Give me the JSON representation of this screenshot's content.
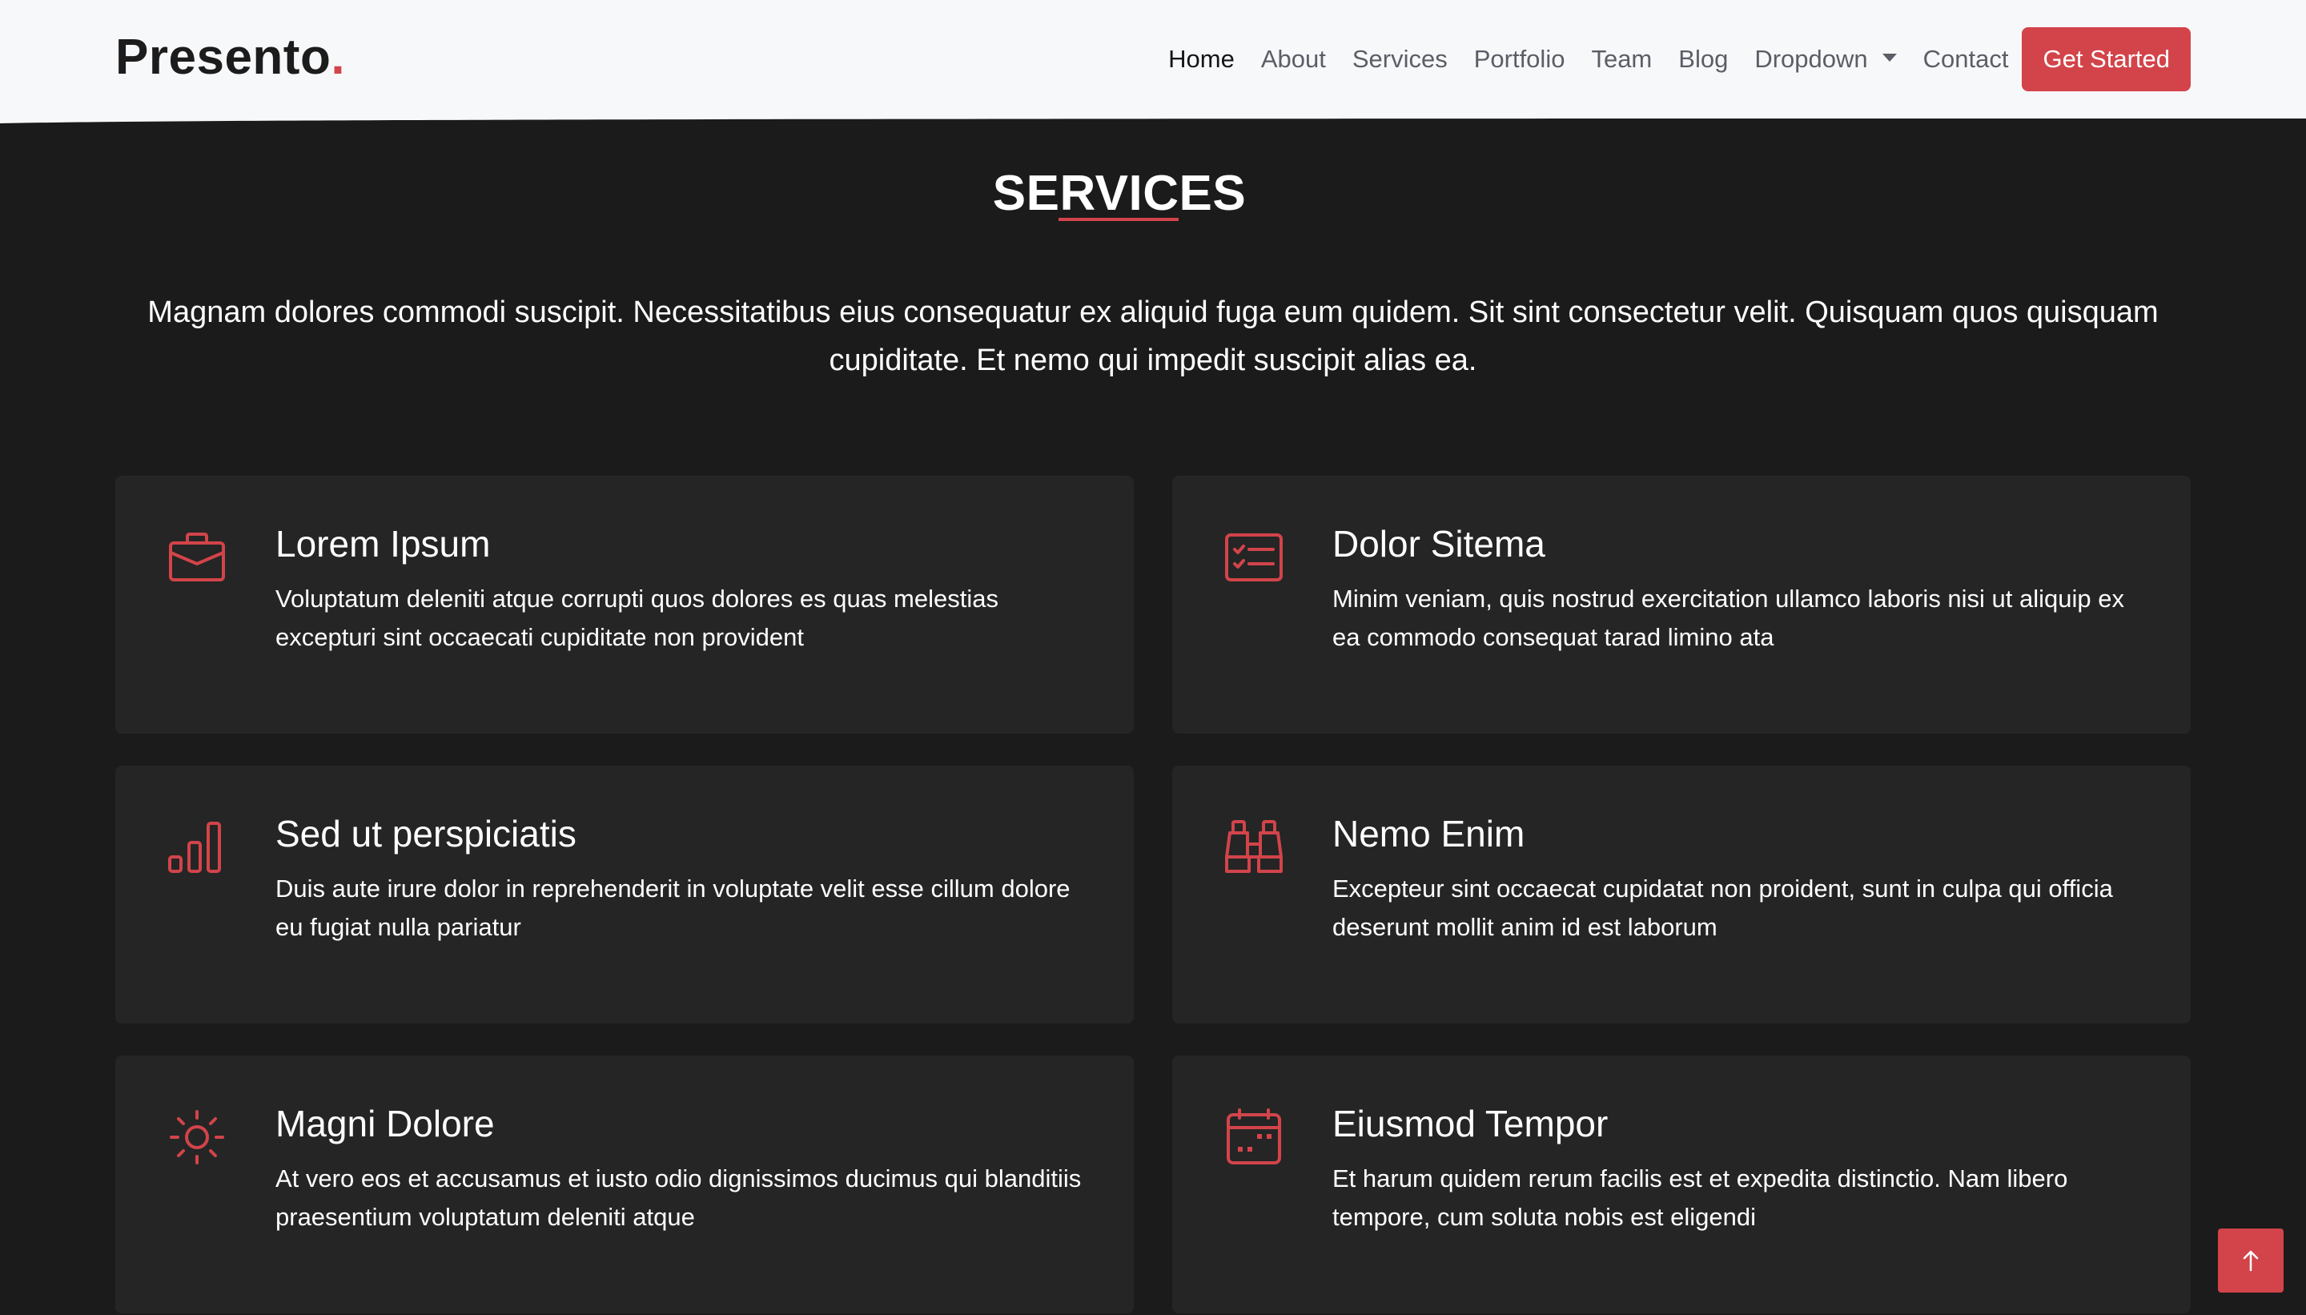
{
  "brand": {
    "name": "Presento",
    "dot": "."
  },
  "nav": {
    "items": [
      {
        "label": "Home",
        "active": true
      },
      {
        "label": "About"
      },
      {
        "label": "Services"
      },
      {
        "label": "Portfolio"
      },
      {
        "label": "Team"
      },
      {
        "label": "Blog"
      },
      {
        "label": "Dropdown",
        "has_caret": true
      },
      {
        "label": "Contact"
      }
    ],
    "cta": "Get Started"
  },
  "section": {
    "title": "SERVICES",
    "description": "Magnam dolores commodi suscipit. Necessitatibus eius consequatur ex aliquid fuga eum quidem. Sit sint consectetur velit. Quisquam quos quisquam cupiditate. Et nemo qui impedit suscipit alias ea."
  },
  "services": [
    {
      "icon": "briefcase-icon",
      "title": "Lorem Ipsum",
      "description": "Voluptatum deleniti atque corrupti quos dolores es quas melestias excepturi sint occaecati cupiditate non provident"
    },
    {
      "icon": "card-checklist-icon",
      "title": "Dolor Sitema",
      "description": "Minim veniam, quis nostrud exercitation ullamco laboris nisi ut aliquip ex ea commodo consequat tarad limino ata"
    },
    {
      "icon": "bar-chart-icon",
      "title": "Sed ut perspiciatis",
      "description": "Duis aute irure dolor in reprehenderit in voluptate velit esse cillum dolore eu fugiat nulla pariatur"
    },
    {
      "icon": "binoculars-icon",
      "title": "Nemo Enim",
      "description": "Excepteur sint occaecat cupidatat non proident, sunt in culpa qui officia deserunt mollit anim id est laborum"
    },
    {
      "icon": "brightness-icon",
      "title": "Magni Dolore",
      "description": "At vero eos et accusamus et iusto odio dignissimos ducimus qui blanditiis praesentium voluptatum deleniti atque"
    },
    {
      "icon": "calendar-icon",
      "title": "Eiusmod Tempor",
      "description": "Et harum quidem rerum facilis est et expedita distinctio. Nam libero tempore, cum soluta nobis est eligendi"
    }
  ],
  "colors": {
    "accent": "#d2444a",
    "background": "#1b1b1b",
    "card": "#252525",
    "header": "#f7f8fa"
  },
  "back_to_top_icon": "arrow-up-icon"
}
